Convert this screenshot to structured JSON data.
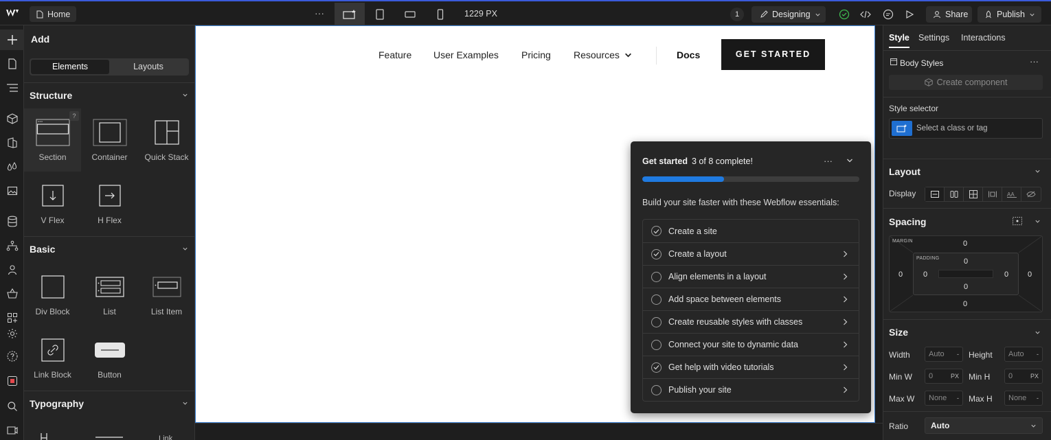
{
  "topbar": {
    "page_name": "Home",
    "canvas_width": "1229 PX",
    "notification_count": "1",
    "mode_label": "Designing",
    "share_label": "Share",
    "publish_label": "Publish"
  },
  "add_panel": {
    "title": "Add",
    "tabs": [
      "Elements",
      "Layouts"
    ],
    "sections": {
      "structure": {
        "title": "Structure",
        "items": [
          "Section",
          "Container",
          "Quick Stack",
          "V Flex",
          "H Flex"
        ]
      },
      "basic": {
        "title": "Basic",
        "items": [
          "Div Block",
          "List",
          "List Item",
          "Link Block",
          "Button"
        ]
      },
      "typography": {
        "title": "Typography"
      }
    },
    "help_badge": "?"
  },
  "canvas": {
    "nav": [
      "Feature",
      "User Examples",
      "Pricing",
      "Resources"
    ],
    "docs_label": "Docs",
    "cta_label": "GET STARTED"
  },
  "get_started": {
    "title": "Get started",
    "status": "3 of 8 complete!",
    "progress": 0.375,
    "subtitle": "Build your site faster with these Webflow essentials:",
    "items": [
      {
        "label": "Create a site",
        "done": true,
        "arrow": false
      },
      {
        "label": "Create a layout",
        "done": true,
        "arrow": true
      },
      {
        "label": "Align elements in a layout",
        "done": false,
        "arrow": true
      },
      {
        "label": "Add space between elements",
        "done": false,
        "arrow": true
      },
      {
        "label": "Create reusable styles with classes",
        "done": false,
        "arrow": true
      },
      {
        "label": "Connect your site to dynamic data",
        "done": false,
        "arrow": true
      },
      {
        "label": "Get help with video tutorials",
        "done": true,
        "arrow": true
      },
      {
        "label": "Publish your site",
        "done": false,
        "arrow": true
      }
    ]
  },
  "right_panel": {
    "tabs": [
      "Style",
      "Settings",
      "Interactions"
    ],
    "element_label": "Body Styles",
    "create_component": "Create component",
    "style_selector_label": "Style selector",
    "selector_placeholder": "Select a class or tag",
    "layout": {
      "title": "Layout",
      "display_label": "Display"
    },
    "spacing": {
      "title": "Spacing",
      "margin_label": "MARGIN",
      "padding_label": "PADDING",
      "margin": {
        "top": "0",
        "right": "0",
        "bottom": "0",
        "left": "0"
      },
      "padding": {
        "top": "0",
        "right": "0",
        "bottom": "0",
        "left": "0"
      }
    },
    "size": {
      "title": "Size",
      "width_label": "Width",
      "width_value": "Auto",
      "width_unit": "-",
      "height_label": "Height",
      "height_value": "Auto",
      "height_unit": "-",
      "minw_label": "Min W",
      "minw_value": "0",
      "minw_unit": "PX",
      "minh_label": "Min H",
      "minh_value": "0",
      "minh_unit": "PX",
      "maxw_label": "Max W",
      "maxw_value": "None",
      "maxw_unit": "-",
      "maxh_label": "Max H",
      "maxh_value": "None",
      "maxh_unit": "-",
      "ratio_label": "Ratio",
      "ratio_value": "Auto"
    }
  },
  "colors": {
    "accent_blue": "#1f7ae0",
    "success_green": "#3fb950",
    "canvas_border": "#3b82d6"
  }
}
